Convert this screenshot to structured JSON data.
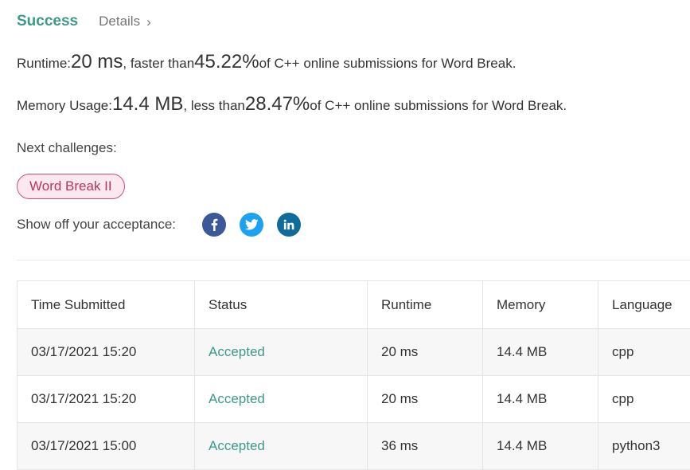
{
  "header": {
    "status": "Success",
    "details_label": "Details",
    "details_chevron": "›"
  },
  "runtime_line": {
    "label": "Runtime: ",
    "value": "20 ms",
    "mid": ", faster than ",
    "percent": "45.22%",
    "suffix": " of C++ online submissions for Word Break."
  },
  "memory_line": {
    "label": "Memory Usage: ",
    "value": "14.4 MB",
    "mid": ", less than ",
    "percent": "28.47%",
    "suffix": " of C++ online submissions for Word Break."
  },
  "next": {
    "label": "Next challenges:",
    "challenges": [
      "Word Break II"
    ]
  },
  "share": {
    "label": "Show off your acceptance:",
    "icons": [
      "facebook-icon",
      "twitter-icon",
      "linkedin-icon"
    ]
  },
  "colors": {
    "accent": "#3d9a8b",
    "facebook": "#3b5998",
    "twitter": "#1da1f2",
    "linkedin": "#0e6b9a",
    "tag_border": "#d24a7c",
    "tag_bg": "#fce8ef"
  },
  "table": {
    "headers": [
      "Time Submitted",
      "Status",
      "Runtime",
      "Memory",
      "Language"
    ],
    "rows": [
      [
        "03/17/2021 15:20",
        "Accepted",
        "20 ms",
        "14.4 MB",
        "cpp"
      ],
      [
        "03/17/2021 15:20",
        "Accepted",
        "20 ms",
        "14.4 MB",
        "cpp"
      ],
      [
        "03/17/2021 15:00",
        "Accepted",
        "36 ms",
        "14.4 MB",
        "python3"
      ]
    ]
  }
}
